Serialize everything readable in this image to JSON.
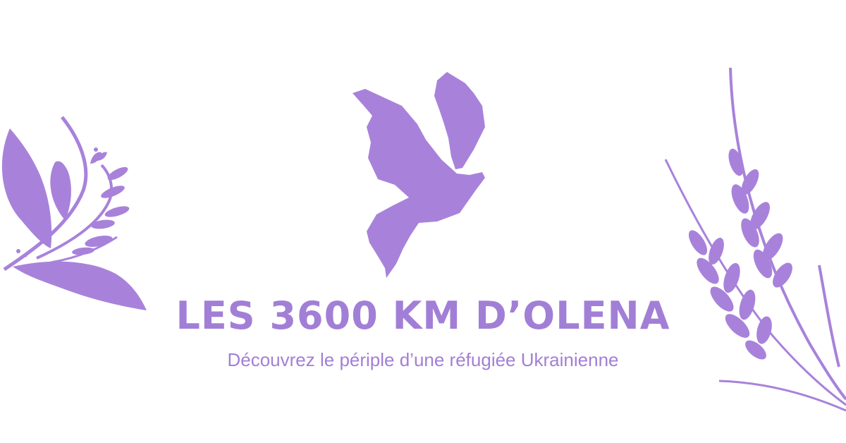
{
  "banner": {
    "title": "LES 3600 KM D’OLENA",
    "subtitle": "Découvrez le périple d’une réfugiée Ukrainienne"
  },
  "icons": [
    "floral-branch-icon",
    "dove-icon",
    "wheat-icon"
  ],
  "colors": {
    "accent": "#a27fd6",
    "art": "#a882da",
    "background": "#ffffff"
  }
}
